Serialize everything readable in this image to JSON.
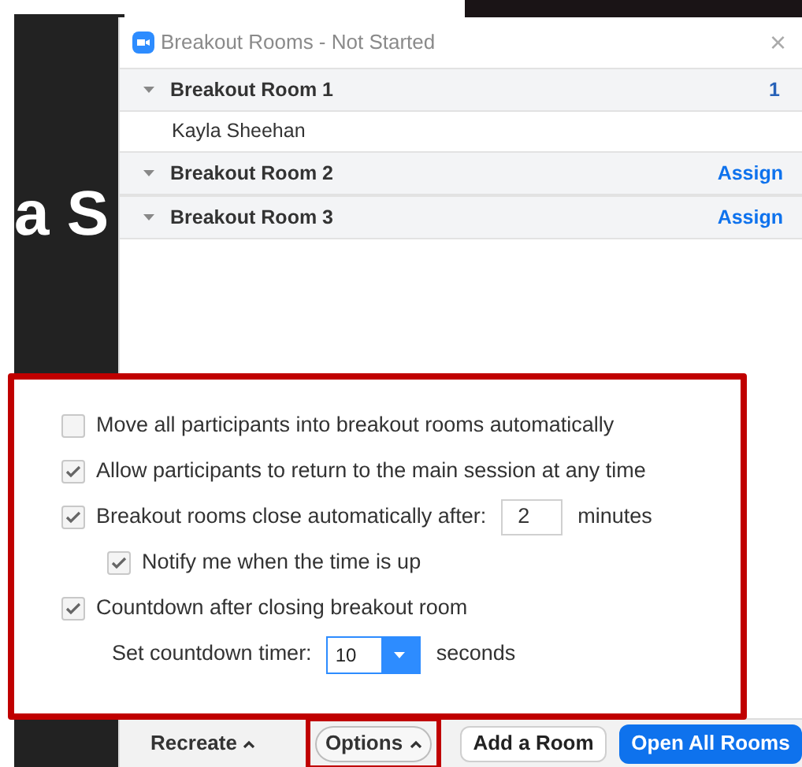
{
  "video": {
    "name_text": "a S"
  },
  "window": {
    "title": "Breakout Rooms - Not Started",
    "close": "×"
  },
  "rooms": [
    {
      "name": "Breakout Room 1",
      "trailing": {
        "kind": "count",
        "text": "1"
      },
      "participants": [
        "Kayla Sheehan"
      ]
    },
    {
      "name": "Breakout Room 2",
      "trailing": {
        "kind": "link",
        "text": "Assign"
      }
    },
    {
      "name": "Breakout Room 3",
      "trailing": {
        "kind": "link",
        "text": "Assign"
      }
    }
  ],
  "options": [
    {
      "kind": "checkbox",
      "label": "Move all participants into breakout rooms automatically",
      "checked": false
    },
    {
      "kind": "checkbox",
      "label": "Allow participants to return to the main session at any time",
      "checked": true
    },
    {
      "kind": "checkbox",
      "label": "Breakout rooms close automatically after:",
      "checked": true,
      "field": {
        "value": "2",
        "suffix": "minutes"
      },
      "children": [
        {
          "kind": "checkbox",
          "label": "Notify me when the time is up",
          "checked": true
        }
      ]
    },
    {
      "kind": "checkbox",
      "label": "Countdown after closing breakout room",
      "checked": true,
      "children": [
        {
          "kind": "select",
          "label": "Set countdown timer:",
          "value": "10",
          "suffix": "seconds"
        }
      ]
    }
  ],
  "footer": [
    {
      "kind": "menu",
      "label": "Recreate",
      "highlighted": false
    },
    {
      "kind": "pill",
      "label": "Options",
      "highlighted": true
    },
    {
      "kind": "outline",
      "label": "Add a Room",
      "highlighted": false
    },
    {
      "kind": "primary",
      "label": "Open All Rooms",
      "highlighted": false
    }
  ]
}
